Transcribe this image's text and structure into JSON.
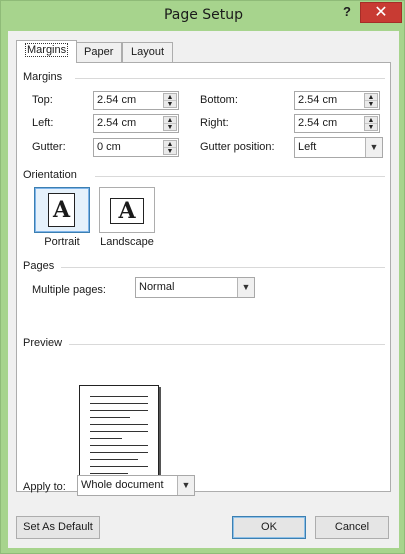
{
  "window": {
    "title": "Page Setup",
    "help_glyph": "?",
    "close_glyph": "✕"
  },
  "tabs": [
    {
      "label": "Margins",
      "active": true
    },
    {
      "label": "Paper",
      "active": false
    },
    {
      "label": "Layout",
      "active": false
    }
  ],
  "margins": {
    "section_label": "Margins",
    "top": {
      "label": "Top:",
      "value": "2.54 cm"
    },
    "bottom": {
      "label": "Bottom:",
      "value": "2.54 cm"
    },
    "left": {
      "label": "Left:",
      "value": "2.54 cm"
    },
    "right": {
      "label": "Right:",
      "value": "2.54 cm"
    },
    "gutter": {
      "label": "Gutter:",
      "value": "0 cm"
    },
    "gutter_position": {
      "label": "Gutter position:",
      "value": "Left"
    }
  },
  "orientation": {
    "section_label": "Orientation",
    "portrait": {
      "label": "Portrait",
      "glyph": "A",
      "selected": true
    },
    "landscape": {
      "label": "Landscape",
      "glyph": "A",
      "selected": false
    }
  },
  "pages": {
    "section_label": "Pages",
    "multiple_pages": {
      "label": "Multiple pages:",
      "value": "Normal"
    }
  },
  "preview": {
    "section_label": "Preview"
  },
  "apply_to": {
    "label": "Apply to:",
    "value": "Whole document"
  },
  "buttons": {
    "set_as_default": "Set As Default",
    "ok": "OK",
    "cancel": "Cancel"
  },
  "colors": {
    "frame": "#a7d48d",
    "close": "#c83b33",
    "selection_accent": "#3c7fb1"
  }
}
